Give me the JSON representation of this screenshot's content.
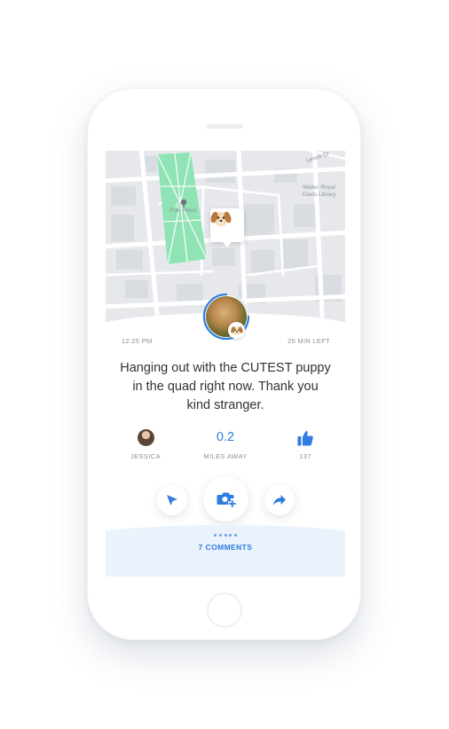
{
  "map": {
    "labels": {
      "park": "Polk Place",
      "library": "Walter Royal Davis Library",
      "street": "Lenoir Dr"
    },
    "pin_icon": "dog-face-emoji"
  },
  "post": {
    "time": "12:25 PM",
    "remaining": "25 MIN LEFT",
    "message": "Hanging out with the CUTEST puppy in the quad right now. Thank you kind stranger."
  },
  "stats": {
    "user_name": "JESSICA",
    "distance_value": "0.2",
    "distance_label": "MILES AWAY",
    "likes": "137"
  },
  "actions": {
    "navigate_icon": "location-arrow-icon",
    "camera_icon": "add-photo-icon",
    "share_icon": "share-arrow-icon"
  },
  "comments": {
    "label": "7 COMMENTS"
  },
  "colors": {
    "accent": "#2f7de1",
    "park": "#8fe3b4",
    "map_bg": "#e7e9ed",
    "text": "#2f3237",
    "muted": "#8a9099"
  }
}
